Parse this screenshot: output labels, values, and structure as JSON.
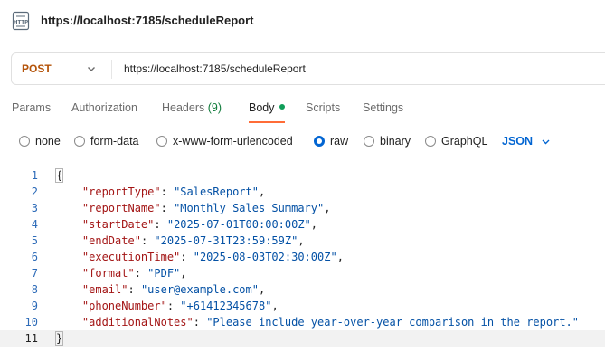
{
  "header": {
    "title": "https://localhost:7185/scheduleReport",
    "icon": "http-file-icon"
  },
  "request": {
    "method": "POST",
    "url": "https://localhost:7185/scheduleReport"
  },
  "tabs": [
    {
      "label": "Params"
    },
    {
      "label": "Authorization"
    },
    {
      "label": "Headers",
      "count": "(9)"
    },
    {
      "label": "Body",
      "active": true,
      "indicator_color": "#0f9d58"
    },
    {
      "label": "Scripts"
    },
    {
      "label": "Settings"
    }
  ],
  "body_types": [
    {
      "label": "none",
      "checked": false
    },
    {
      "label": "form-data",
      "checked": false
    },
    {
      "label": "x-www-form-urlencoded",
      "checked": false
    },
    {
      "label": "raw",
      "checked": true
    },
    {
      "label": "binary",
      "checked": false
    },
    {
      "label": "GraphQL",
      "checked": false
    }
  ],
  "format_select": "JSON",
  "colors": {
    "method": "#b45309",
    "accent": "#ff6c37",
    "link": "#0265d2",
    "key": "#a31515",
    "string": "#0451a5"
  },
  "editor": {
    "lines": [
      {
        "number": "1",
        "open": "{"
      },
      {
        "number": "2",
        "key": "\"reportType\"",
        "value": "\"SalesReport\"",
        "comma": ","
      },
      {
        "number": "3",
        "key": "\"reportName\"",
        "value": "\"Monthly Sales Summary\"",
        "comma": ","
      },
      {
        "number": "4",
        "key": "\"startDate\"",
        "value": "\"2025-07-01T00:00:00Z\"",
        "comma": ","
      },
      {
        "number": "5",
        "key": "\"endDate\"",
        "value": "\"2025-07-31T23:59:59Z\"",
        "comma": ","
      },
      {
        "number": "6",
        "key": "\"executionTime\"",
        "value": "\"2025-08-03T02:30:00Z\"",
        "comma": ","
      },
      {
        "number": "7",
        "key": "\"format\"",
        "value": "\"PDF\"",
        "comma": ","
      },
      {
        "number": "8",
        "key": "\"email\"",
        "value": "\"user@example.com\"",
        "comma": ","
      },
      {
        "number": "9",
        "key": "\"phoneNumber\"",
        "value": "\"+61412345678\"",
        "comma": ","
      },
      {
        "number": "10",
        "key": "\"additionalNotes\"",
        "value": "\"Please include year-over-year comparison in the report.\"",
        "comma": ""
      },
      {
        "number": "11",
        "close": "}"
      }
    ]
  }
}
